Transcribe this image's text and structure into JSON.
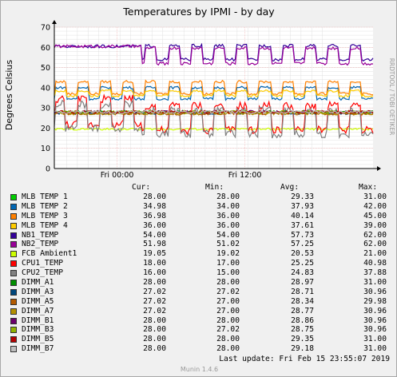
{
  "chart_data": {
    "type": "line",
    "title": "Temperatures by IPMI - by day",
    "ylabel": "Degrees Celsius",
    "ylim": [
      0,
      70
    ],
    "yticks": [
      0,
      10,
      20,
      30,
      40,
      50,
      60,
      70
    ],
    "x_tick_labels": [
      "Fri 00:00",
      "Fri 12:00"
    ],
    "side_label": "RRDTOOL / TOBI OETIKER",
    "grid": true,
    "series": [
      {
        "name": "MLB TEMP 1",
        "color": "#00cc00",
        "pattern": "flat",
        "base": 28.0,
        "amp": 0.8
      },
      {
        "name": "MLB TEMP 2",
        "color": "#0066b3",
        "pattern": "cycle",
        "base": 34.5,
        "amp": 7.0
      },
      {
        "name": "MLB TEMP 3",
        "color": "#ff8000",
        "pattern": "cycle",
        "base": 37.0,
        "amp": 7.5
      },
      {
        "name": "MLB TEMP 4",
        "color": "#ffcc00",
        "pattern": "cycle",
        "base": 36.0,
        "amp": 3.0
      },
      {
        "name": "NB1_TEMP",
        "color": "#330099",
        "pattern": "cycle_high",
        "base": 54.0,
        "amp": 8.0
      },
      {
        "name": "NB2_TEMP",
        "color": "#990099",
        "pattern": "cycle_high",
        "base": 52.0,
        "amp": 9.0
      },
      {
        "name": "FCB Ambient1",
        "color": "#ccff00",
        "pattern": "flat",
        "base": 19.5,
        "amp": 1.0
      },
      {
        "name": "CPU1_TEMP",
        "color": "#ff0000",
        "pattern": "spiky",
        "base": 18.0,
        "amp": 22.0
      },
      {
        "name": "CPU2_TEMP",
        "color": "#808080",
        "pattern": "spiky",
        "base": 16.0,
        "amp": 21.0
      },
      {
        "name": "DIMM_A1",
        "color": "#008f00",
        "pattern": "flat",
        "base": 28.0,
        "amp": 1.5
      },
      {
        "name": "DIMM_A3",
        "color": "#00487d",
        "pattern": "flat",
        "base": 27.5,
        "amp": 1.5
      },
      {
        "name": "DIMM_A5",
        "color": "#b35a00",
        "pattern": "flat",
        "base": 27.2,
        "amp": 1.5
      },
      {
        "name": "DIMM_A7",
        "color": "#b38f00",
        "pattern": "flat",
        "base": 27.3,
        "amp": 1.5
      },
      {
        "name": "DIMM_B1",
        "color": "#6b006b",
        "pattern": "flat",
        "base": 28.0,
        "amp": 1.5
      },
      {
        "name": "DIMM_B3",
        "color": "#8fb300",
        "pattern": "flat",
        "base": 28.0,
        "amp": 1.5
      },
      {
        "name": "DIMM_B5",
        "color": "#b30000",
        "pattern": "flat",
        "base": 28.0,
        "amp": 1.5
      },
      {
        "name": "DIMM_B7",
        "color": "#bebebe",
        "pattern": "flat",
        "base": 28.0,
        "amp": 1.5
      }
    ]
  },
  "legend": {
    "headers": {
      "cur": "Cur:",
      "min": "Min:",
      "avg": "Avg:",
      "max": "Max:"
    },
    "rows": [
      {
        "name": "MLB TEMP 1",
        "cur": "28.00",
        "min": "28.00",
        "avg": "29.33",
        "max": "31.00"
      },
      {
        "name": "MLB TEMP 2",
        "cur": "34.98",
        "min": "34.00",
        "avg": "37.93",
        "max": "42.00"
      },
      {
        "name": "MLB TEMP 3",
        "cur": "36.98",
        "min": "36.00",
        "avg": "40.14",
        "max": "45.00"
      },
      {
        "name": "MLB TEMP 4",
        "cur": "36.00",
        "min": "36.00",
        "avg": "37.61",
        "max": "39.00"
      },
      {
        "name": "NB1_TEMP",
        "cur": "54.00",
        "min": "54.00",
        "avg": "57.73",
        "max": "62.00"
      },
      {
        "name": "NB2_TEMP",
        "cur": "51.98",
        "min": "51.02",
        "avg": "57.25",
        "max": "62.00"
      },
      {
        "name": "FCB Ambient1",
        "cur": "19.05",
        "min": "19.02",
        "avg": "20.53",
        "max": "21.00"
      },
      {
        "name": "CPU1_TEMP",
        "cur": "18.00",
        "min": "17.00",
        "avg": "25.25",
        "max": "40.98"
      },
      {
        "name": "CPU2_TEMP",
        "cur": "16.00",
        "min": "15.00",
        "avg": "24.83",
        "max": "37.88"
      },
      {
        "name": "DIMM_A1",
        "cur": "28.00",
        "min": "28.00",
        "avg": "28.97",
        "max": "31.00"
      },
      {
        "name": "DIMM_A3",
        "cur": "27.02",
        "min": "27.02",
        "avg": "28.71",
        "max": "30.96"
      },
      {
        "name": "DIMM_A5",
        "cur": "27.02",
        "min": "27.00",
        "avg": "28.34",
        "max": "29.98"
      },
      {
        "name": "DIMM_A7",
        "cur": "27.02",
        "min": "27.00",
        "avg": "28.77",
        "max": "30.96"
      },
      {
        "name": "DIMM_B1",
        "cur": "28.00",
        "min": "28.00",
        "avg": "28.86",
        "max": "30.96"
      },
      {
        "name": "DIMM_B3",
        "cur": "28.00",
        "min": "27.02",
        "avg": "28.75",
        "max": "30.96"
      },
      {
        "name": "DIMM_B5",
        "cur": "28.00",
        "min": "28.00",
        "avg": "29.35",
        "max": "31.00"
      },
      {
        "name": "DIMM_B7",
        "cur": "28.00",
        "min": "28.00",
        "avg": "29.18",
        "max": "31.00"
      }
    ]
  },
  "footer": {
    "last_update": "Last update:  Fri Feb 15 23:55:07 2019",
    "version": "Munin 1.4.6"
  }
}
